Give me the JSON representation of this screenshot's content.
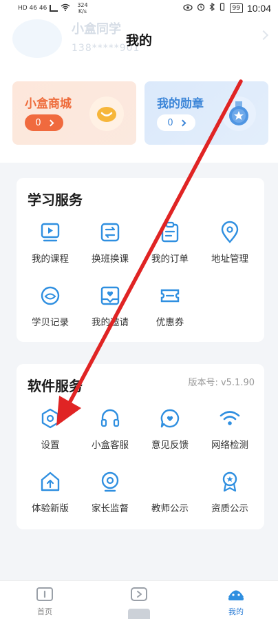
{
  "status_bar": {
    "network": "HD 46 46",
    "speed": "324",
    "speed_unit": "K/s",
    "battery": "99",
    "time": "10:04"
  },
  "header": {
    "title": "我的",
    "ghost_name": "小盒同学",
    "ghost_phone": "138*****901"
  },
  "cards": {
    "shop": {
      "title": "小盒商城",
      "count": "0"
    },
    "medal": {
      "title": "我的勋章",
      "count": "0"
    }
  },
  "study_services": {
    "title": "学习服务",
    "items": [
      {
        "label": "我的课程",
        "icon": "course-icon"
      },
      {
        "label": "换班换课",
        "icon": "swap-icon"
      },
      {
        "label": "我的订单",
        "icon": "order-icon"
      },
      {
        "label": "地址管理",
        "icon": "location-icon"
      },
      {
        "label": "学贝记录",
        "icon": "coin-record-icon"
      },
      {
        "label": "我的邀请",
        "icon": "invite-icon"
      },
      {
        "label": "优惠券",
        "icon": "coupon-icon"
      }
    ]
  },
  "software_services": {
    "title": "软件服务",
    "version": "版本号: v5.1.90",
    "items": [
      {
        "label": "设置",
        "icon": "settings-icon"
      },
      {
        "label": "小盒客服",
        "icon": "headset-icon"
      },
      {
        "label": "意见反馈",
        "icon": "feedback-icon"
      },
      {
        "label": "网络检测",
        "icon": "wifi-icon"
      },
      {
        "label": "体验新版",
        "icon": "upgrade-icon"
      },
      {
        "label": "家长监督",
        "icon": "parent-icon"
      },
      {
        "label": "教师公示",
        "icon": "teacher-icon"
      },
      {
        "label": "资质公示",
        "icon": "award-icon"
      }
    ]
  },
  "bottom_nav": {
    "items": [
      {
        "label": "首页",
        "icon": "home-icon"
      },
      {
        "label": "",
        "icon": "play-icon"
      },
      {
        "label": "我的",
        "icon": "profile-icon"
      }
    ],
    "active_index": 2
  },
  "colors": {
    "accent_blue": "#2f8fe0",
    "shop_orange": "#f06a3e",
    "annotation_red": "#e02424"
  }
}
